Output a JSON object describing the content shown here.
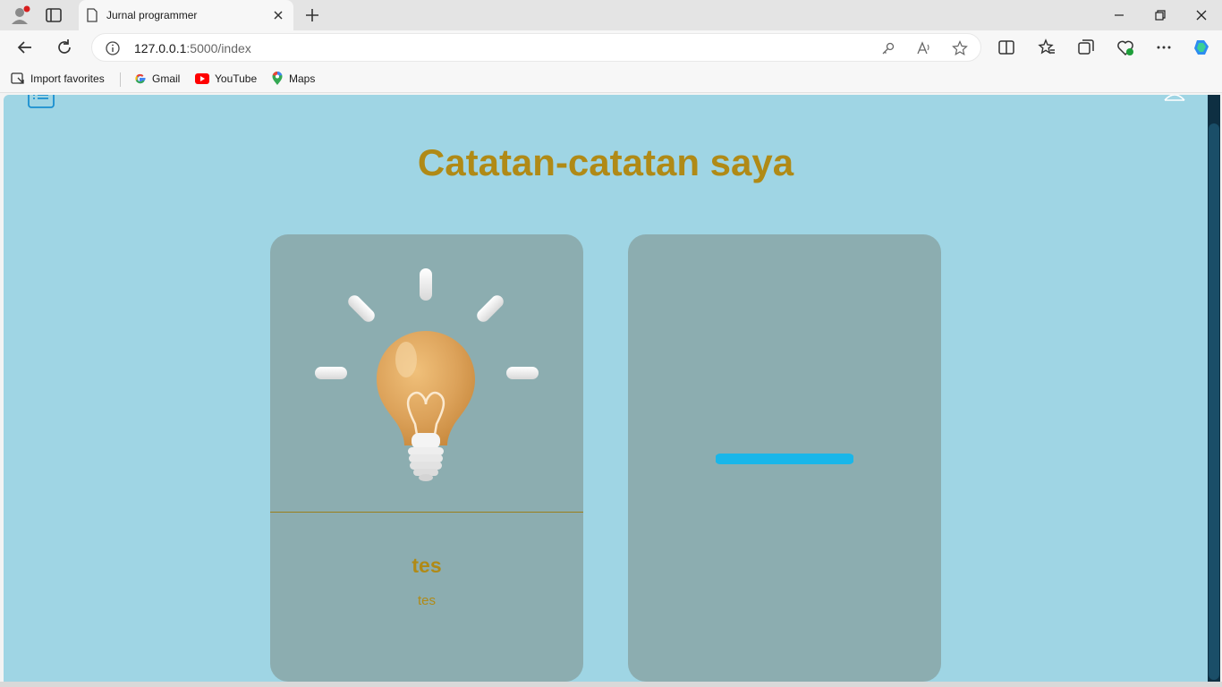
{
  "browser": {
    "tab_title": "Jurnal programmer",
    "url_host": "127.0.0.1",
    "url_path": ":5000/index",
    "favorites": [
      {
        "label": "Import favorites",
        "icon": "import-favorites-icon"
      },
      {
        "label": "Gmail",
        "icon": "google-icon"
      },
      {
        "label": "YouTube",
        "icon": "youtube-icon"
      },
      {
        "label": "Maps",
        "icon": "maps-icon"
      }
    ]
  },
  "page": {
    "title": "Catatan-catatan saya",
    "notes": [
      {
        "title": "tes",
        "text": "tes",
        "image": "lightbulb-icon"
      }
    ],
    "add_note_icon": "plus-icon"
  },
  "colors": {
    "background": "#9fd5e4",
    "card": "#8cadb0",
    "accent_text": "#b08a16",
    "plus": "#1bb8e8"
  }
}
